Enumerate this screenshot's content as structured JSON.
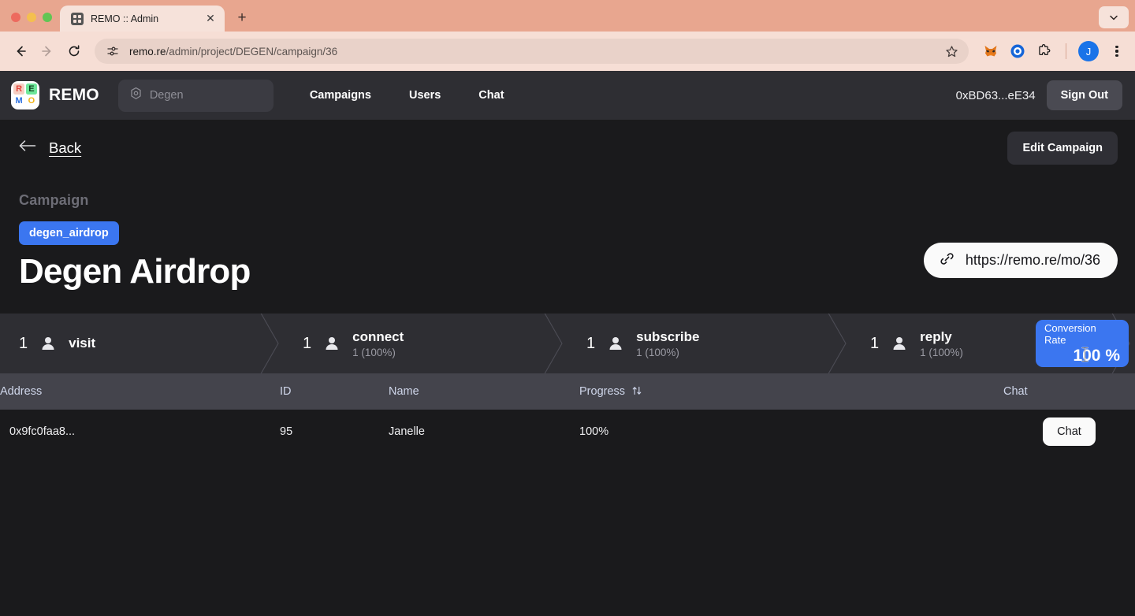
{
  "browser": {
    "tab": {
      "title": "REMO :: Admin",
      "favicon": "remo-favicon-icon",
      "close": "✕"
    },
    "new_tab": "+",
    "tabstrip_chevron": "⌄",
    "back": "←",
    "forward": "→",
    "reload": "↻",
    "omnibox": {
      "site_info_icon": "tune-icon",
      "url_host": "remo.re",
      "url_path": "/admin/project/DEGEN/campaign/36",
      "full_url": "remo.re/admin/project/DEGEN/campaign/36",
      "star": "☆"
    },
    "extensions": [
      "metamask-fox-icon",
      "blue-target-icon",
      "puzzle-extensions-icon"
    ],
    "profile_initial": "J"
  },
  "app_header": {
    "logo_cells": [
      {
        "letter": "R",
        "class": "lc-r"
      },
      {
        "letter": "E",
        "class": "lc-e"
      },
      {
        "letter": "M",
        "class": "lc-m"
      },
      {
        "letter": "O",
        "class": "lc-o"
      }
    ],
    "brand": "REMO",
    "project_select": {
      "icon": "hexagon-dot-icon",
      "label": "Degen"
    },
    "nav": [
      {
        "label": "Campaigns"
      },
      {
        "label": "Users"
      },
      {
        "label": "Chat"
      }
    ],
    "wallet": "0xBD63...eE34",
    "sign_out": "Sign Out"
  },
  "subbar": {
    "back_arrow": "←",
    "back_label": "Back",
    "edit_campaign": "Edit Campaign"
  },
  "hero": {
    "eyebrow": "Campaign",
    "tag": "degen_airdrop",
    "title": "Degen Airdrop",
    "link": {
      "icon": "link-chain-icon",
      "text": "https://remo.re/mo/36"
    }
  },
  "funnel": {
    "steps": [
      {
        "count": "1",
        "label": "visit",
        "sub": ""
      },
      {
        "count": "1",
        "label": "connect",
        "sub": "1 (100%)"
      },
      {
        "count": "1",
        "label": "subscribe",
        "sub": "1 (100%)"
      },
      {
        "count": "1",
        "label": "reply",
        "sub": "1 (100%)"
      }
    ],
    "conversion": {
      "label": "Conversion Rate",
      "value": "100 %"
    }
  },
  "table": {
    "columns": [
      {
        "key": "address",
        "label": "Address",
        "sortable": false
      },
      {
        "key": "id",
        "label": "ID",
        "sortable": false
      },
      {
        "key": "name",
        "label": "Name",
        "sortable": false
      },
      {
        "key": "progress",
        "label": "Progress",
        "sortable": true,
        "sort_glyph": "↑↓"
      },
      {
        "key": "chat",
        "label": "Chat",
        "sortable": false
      }
    ],
    "rows": [
      {
        "address": "0x9fc0faa8...",
        "id": "95",
        "name": "Janelle",
        "progress": "100%",
        "chat_button": "Chat"
      }
    ]
  },
  "colors": {
    "page_bg": "#1a1a1c",
    "header_bg": "#2e2e33",
    "accent_blue": "#3b76f0",
    "table_header_bg": "#44444c",
    "chrome_tabstrip": "#e8a68f",
    "chrome_toolbar": "#f6ded5"
  }
}
